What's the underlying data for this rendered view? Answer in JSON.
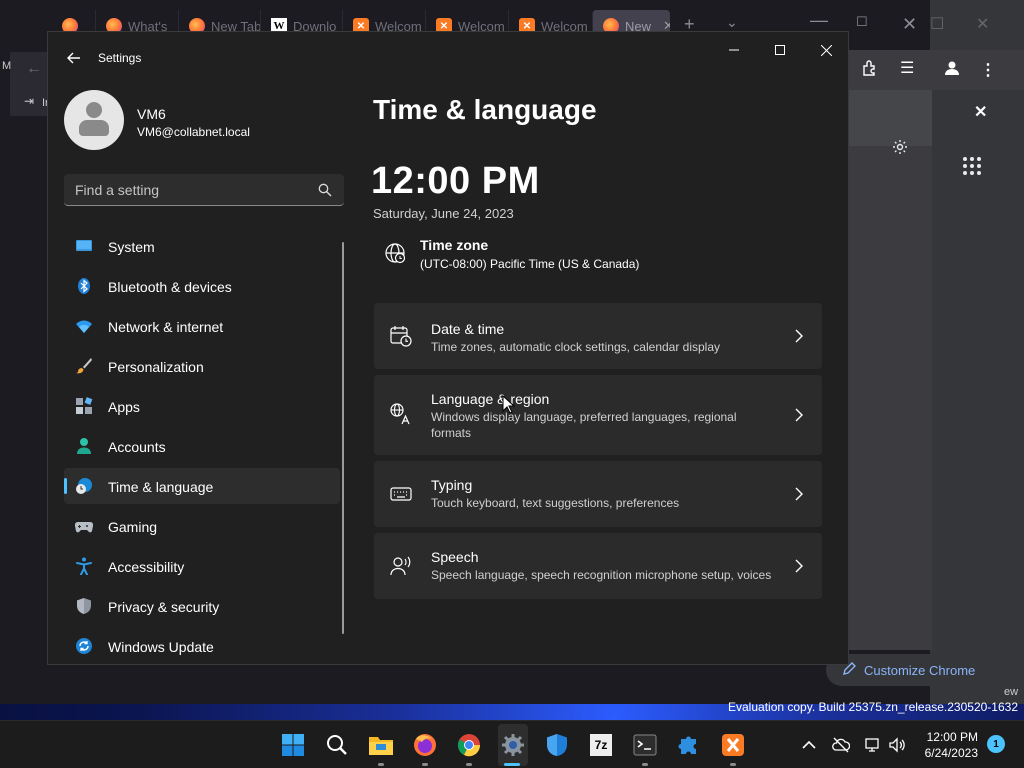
{
  "background": {
    "firefox_tabs": [
      {
        "label": "What's",
        "icon": "firefox-icon"
      },
      {
        "label": "New Tab",
        "icon": "firefox-icon"
      },
      {
        "label": "Downlo",
        "icon": "wikipedia-icon"
      },
      {
        "label": "Welcom",
        "icon": "xampp-icon"
      },
      {
        "label": "Welcom",
        "icon": "xampp-icon"
      },
      {
        "label": "Welcom",
        "icon": "xampp-icon"
      },
      {
        "label": "New",
        "icon": "firefox-icon"
      }
    ],
    "bookmark_fragment": "In",
    "left_fragment": "M",
    "right_fragment": "ew",
    "customize_chrome_label": "Customize Chrome",
    "watermark": "Evaluation copy. Build 25375.zn_release.230520-1632"
  },
  "settings": {
    "app_title": "Settings",
    "user": {
      "name": "VM6",
      "email": "VM6@collabnet.local"
    },
    "search": {
      "placeholder": "Find a setting"
    },
    "nav": [
      {
        "label": "System",
        "icon": "system-monitor-icon"
      },
      {
        "label": "Bluetooth & devices",
        "icon": "bluetooth-icon"
      },
      {
        "label": "Network & internet",
        "icon": "wifi-icon"
      },
      {
        "label": "Personalization",
        "icon": "paintbrush-icon"
      },
      {
        "label": "Apps",
        "icon": "apps-icon"
      },
      {
        "label": "Accounts",
        "icon": "account-icon"
      },
      {
        "label": "Time & language",
        "icon": "globe-clock-icon",
        "selected": true
      },
      {
        "label": "Gaming",
        "icon": "gamepad-icon"
      },
      {
        "label": "Accessibility",
        "icon": "accessibility-icon"
      },
      {
        "label": "Privacy & security",
        "icon": "shield-icon"
      },
      {
        "label": "Windows Update",
        "icon": "update-icon"
      }
    ],
    "page": {
      "title": "Time & language",
      "time": "12:00 PM",
      "date": "Saturday, June 24, 2023",
      "timezone_title": "Time zone",
      "timezone_value": "(UTC-08:00) Pacific Time (US & Canada)",
      "cards": [
        {
          "title": "Date & time",
          "desc": "Time zones, automatic clock settings, calendar display",
          "icon": "calendar-clock-icon"
        },
        {
          "title": "Language & region",
          "desc": "Windows display language, preferred languages, regional formats",
          "icon": "language-icon"
        },
        {
          "title": "Typing",
          "desc": "Touch keyboard, text suggestions, preferences",
          "icon": "keyboard-icon"
        },
        {
          "title": "Speech",
          "desc": "Speech language, speech recognition microphone setup, voices",
          "icon": "speech-icon"
        }
      ]
    }
  },
  "taskbar": {
    "clock_time": "12:00 PM",
    "clock_date": "6/24/2023",
    "notification_count": "1",
    "apps": [
      "start-icon",
      "search-icon",
      "file-explorer-icon",
      "firefox-icon",
      "chrome-icon",
      "settings-icon",
      "defender-icon",
      "7zip-icon",
      "terminal-icon",
      "puzzle-app-icon",
      "xampp-icon"
    ],
    "sevenzip_label": "7z"
  },
  "colors": {
    "accent": "#4cc2ff",
    "window_bg": "#202020",
    "card_bg": "#2b2b2b"
  }
}
